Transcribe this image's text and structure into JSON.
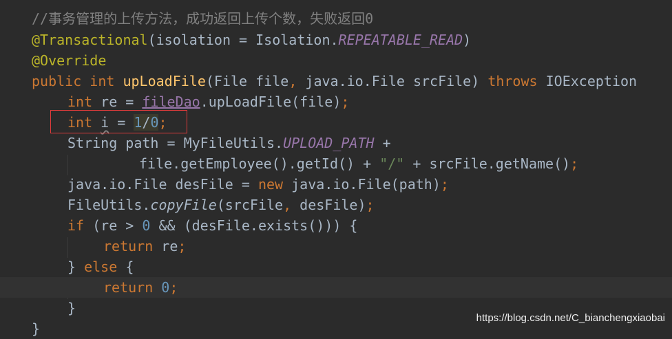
{
  "editor": {
    "lines": [
      {
        "segments": [
          {
            "t": "//事务管理的上传方法，成功返回上传个数，失败返回0",
            "k": "comment"
          }
        ]
      },
      {
        "segments": [
          {
            "t": "@Transactional",
            "k": "annotation"
          },
          {
            "t": "(isolation = Isolation.",
            "k": "plain"
          },
          {
            "t": "REPEATABLE_READ",
            "k": "static"
          },
          {
            "t": ")",
            "k": "plain"
          }
        ]
      },
      {
        "segments": [
          {
            "t": "@Override",
            "k": "annotation"
          }
        ]
      },
      {
        "segments": [
          {
            "t": "public ",
            "k": "keyword"
          },
          {
            "t": "int ",
            "k": "keyword"
          },
          {
            "t": "upLoadFile",
            "k": "method"
          },
          {
            "t": "(File file",
            "k": "plain"
          },
          {
            "t": ", ",
            "k": "keyword"
          },
          {
            "t": "java.io.File srcFile) ",
            "k": "plain"
          },
          {
            "t": "throws ",
            "k": "keyword"
          },
          {
            "t": "IOException",
            "k": "plain"
          }
        ]
      },
      {
        "segments": [
          {
            "t": "int ",
            "k": "keyword"
          },
          {
            "t": "re = ",
            "k": "plain"
          },
          {
            "t": "fileDao",
            "k": "field"
          },
          {
            "t": ".upLoadFile(file)",
            "k": "plain"
          },
          {
            "t": ";",
            "k": "keyword"
          }
        ]
      },
      {
        "segments": [
          {
            "t": "int ",
            "k": "keyword"
          },
          {
            "t": "i",
            "k": "wavy"
          },
          {
            "t": " = ",
            "k": "plain"
          },
          {
            "t": "1",
            "k": "number-hl"
          },
          {
            "t": "/",
            "k": "plain-hl"
          },
          {
            "t": "0",
            "k": "number-hl"
          },
          {
            "t": ";",
            "k": "keyword"
          }
        ]
      },
      {
        "segments": [
          {
            "t": "String path = MyFileUtils.",
            "k": "plain"
          },
          {
            "t": "UPLOAD_PATH",
            "k": "static"
          },
          {
            "t": " +",
            "k": "plain"
          }
        ]
      },
      {
        "segments": [
          {
            "t": "file.getEmployee().getId() + ",
            "k": "plain"
          },
          {
            "t": "\"/\"",
            "k": "string"
          },
          {
            "t": " + srcFile.getName()",
            "k": "plain"
          },
          {
            "t": ";",
            "k": "keyword"
          }
        ]
      },
      {
        "segments": [
          {
            "t": "java.io.File desFile = ",
            "k": "plain"
          },
          {
            "t": "new ",
            "k": "keyword"
          },
          {
            "t": "java.io.File(path)",
            "k": "plain"
          },
          {
            "t": ";",
            "k": "keyword"
          }
        ]
      },
      {
        "segments": [
          {
            "t": "FileUtils.",
            "k": "plain"
          },
          {
            "t": "copyFile",
            "k": "italic"
          },
          {
            "t": "(srcFile",
            "k": "plain"
          },
          {
            "t": ", ",
            "k": "keyword"
          },
          {
            "t": "desFile)",
            "k": "plain"
          },
          {
            "t": ";",
            "k": "keyword"
          }
        ]
      },
      {
        "segments": [
          {
            "t": "if ",
            "k": "keyword"
          },
          {
            "t": "(re > ",
            "k": "plain"
          },
          {
            "t": "0 ",
            "k": "number"
          },
          {
            "t": "&& (desFile.exists())) {",
            "k": "plain"
          }
        ]
      },
      {
        "segments": [
          {
            "t": "return ",
            "k": "keyword"
          },
          {
            "t": "re",
            "k": "plain"
          },
          {
            "t": ";",
            "k": "keyword"
          }
        ]
      },
      {
        "segments": [
          {
            "t": "} ",
            "k": "plain"
          },
          {
            "t": "else ",
            "k": "keyword"
          },
          {
            "t": "{",
            "k": "plain"
          }
        ]
      },
      {
        "segments": [
          {
            "t": "return ",
            "k": "keyword"
          },
          {
            "t": "0",
            "k": "number"
          },
          {
            "t": ";",
            "k": "keyword"
          }
        ]
      },
      {
        "segments": [
          {
            "t": "}",
            "k": "plain"
          }
        ]
      },
      {
        "segments": [
          {
            "t": "}",
            "k": "plain"
          }
        ]
      }
    ],
    "current_line_index": 13
  },
  "watermark": "https://blog.csdn.net/C_bianchengxiaobai",
  "colors": {
    "background": "#2b2b2b",
    "current_line": "#323232",
    "error_box": "#e03b3b",
    "comment": "#808080",
    "annotation": "#bbb529",
    "keyword": "#cc7832",
    "method": "#ffc66d",
    "field": "#9876aa",
    "number": "#6897bb",
    "string": "#6a8759",
    "plain": "#a9b7c6"
  }
}
